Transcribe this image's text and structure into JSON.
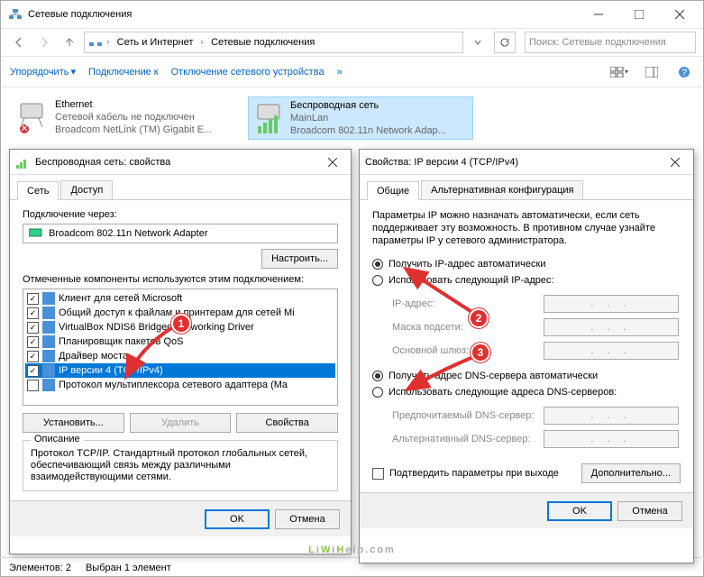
{
  "window": {
    "title": "Сетевые подключения",
    "breadcrumb": [
      "Сеть и Интернет",
      "Сетевые подключения"
    ],
    "search_placeholder": "Поиск: Сетевые подключения"
  },
  "toolbar": {
    "organize": "Упорядочить",
    "connect": "Подключение к",
    "disable": "Отключение сетевого устройства",
    "more": "»"
  },
  "connections": [
    {
      "name": "Ethernet",
      "status": "Сетевой кабель не подключен",
      "adapter": "Broadcom NetLink (TM) Gigabit E..."
    },
    {
      "name": "Беспроводная сеть",
      "status": "MainLan",
      "adapter": "Broadcom 802.11n Network Adap..."
    }
  ],
  "prop_dlg": {
    "title": "Беспроводная сеть: свойства",
    "tabs": [
      "Сеть",
      "Доступ"
    ],
    "conn_through_label": "Подключение через:",
    "adapter_name": "Broadcom 802.11n Network Adapter",
    "configure_btn": "Настроить...",
    "components_label": "Отмеченные компоненты используются этим подключением:",
    "components": [
      {
        "checked": true,
        "label": "Клиент для сетей Microsoft"
      },
      {
        "checked": true,
        "label": "Общий доступ к файлам и принтерам для сетей Mi"
      },
      {
        "checked": true,
        "label": "VirtualBox NDIS6 Bridged Networking Driver"
      },
      {
        "checked": true,
        "label": "Планировщик пакетов QoS"
      },
      {
        "checked": true,
        "label": "Драйвер моста"
      },
      {
        "checked": true,
        "label": "IP версии 4 (TCP/IPv4)",
        "selected": true
      },
      {
        "checked": false,
        "label": "Протокол мультиплексора сетевого адаптера (Ma"
      }
    ],
    "install_btn": "Установить...",
    "remove_btn": "Удалить",
    "props_btn": "Свойства",
    "desc_legend": "Описание",
    "desc_text": "Протокол TCP/IP. Стандартный протокол глобальных сетей, обеспечивающий связь между различными взаимодействующими сетями.",
    "ok": "OK",
    "cancel": "Отмена"
  },
  "ipv4_dlg": {
    "title": "Свойства: IP версии 4 (TCP/IPv4)",
    "tabs": [
      "Общие",
      "Альтернативная конфигурация"
    ],
    "intro": "Параметры IP можно назначать автоматически, если сеть поддерживает эту возможность. В противном случае узнайте параметры IP у сетевого администратора.",
    "auto_ip": "Получить IP-адрес автоматически",
    "manual_ip": "Использовать следующий IP-адрес:",
    "ip_label": "IP-адрес:",
    "mask_label": "Маска подсети:",
    "gw_label": "Основной шлюз:",
    "auto_dns": "Получить адрес DNS-сервера автоматически",
    "manual_dns": "Использовать следующие адреса DNS-серверов:",
    "dns1_label": "Предпочитаемый DNS-сервер:",
    "dns2_label": "Альтернативный DNS-сервер:",
    "confirm_exit": "Подтвердить параметры при выходе",
    "advanced_btn": "Дополнительно...",
    "ok": "OK",
    "cancel": "Отмена"
  },
  "badges": {
    "b1": "1",
    "b2": "2",
    "b3": "3"
  },
  "statusbar": {
    "elements": "Элементов: 2",
    "selected": "Выбран 1 элемент"
  },
  "watermark": {
    "text": "LiWiHelp.com"
  }
}
